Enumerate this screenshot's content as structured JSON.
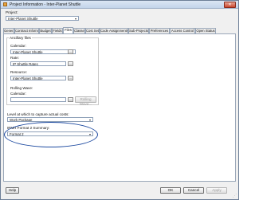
{
  "window": {
    "title": "Project Information - Inter-Planet Shuttle",
    "close_label": "✕"
  },
  "project": {
    "label": "Project:",
    "value": "Inter-Planet Shuttle"
  },
  "tabs": [
    {
      "label": "General"
    },
    {
      "label": "Contract Information"
    },
    {
      "label": "Budget"
    },
    {
      "label": "Fields"
    },
    {
      "label": "Files"
    },
    {
      "label": "Classes"
    },
    {
      "label": "Cost Sets"
    },
    {
      "label": "Code Assignments"
    },
    {
      "label": "Sub-Projects"
    },
    {
      "label": "Preferences"
    },
    {
      "label": "Access Control"
    },
    {
      "label": "Open Status"
    }
  ],
  "active_tab": "Files",
  "ancillary": {
    "group_label": "Ancillary files",
    "calendar": {
      "label": "Calendar:",
      "value": "Inter-Planet Shuttle"
    },
    "rate": {
      "label": "Rate:",
      "value": "IP Shuttle Rates"
    },
    "resource": {
      "label": "Resource:",
      "value": "Inter-Planet Shuttle"
    }
  },
  "rolling_wave": {
    "label": "Rolling Wave:",
    "calendar_label": "Calendar:",
    "calendar_value": "",
    "button_label": "Rolling Wave..."
  },
  "capture": {
    "label": "Level at which to capture actual costs:",
    "value": "Work Package"
  },
  "ipmr": {
    "label": "IPMR Format 2 Summary:",
    "value": "Format 2"
  },
  "buttons": {
    "help": "Help",
    "ok": "OK",
    "cancel": "Cancel",
    "apply": "Apply"
  },
  "icons": {
    "browse": "...",
    "dropdown": "▾"
  },
  "colors": {
    "highlight": "#1d4aa0",
    "titlebar": "#c3d4ea",
    "close": "#c9472f"
  }
}
